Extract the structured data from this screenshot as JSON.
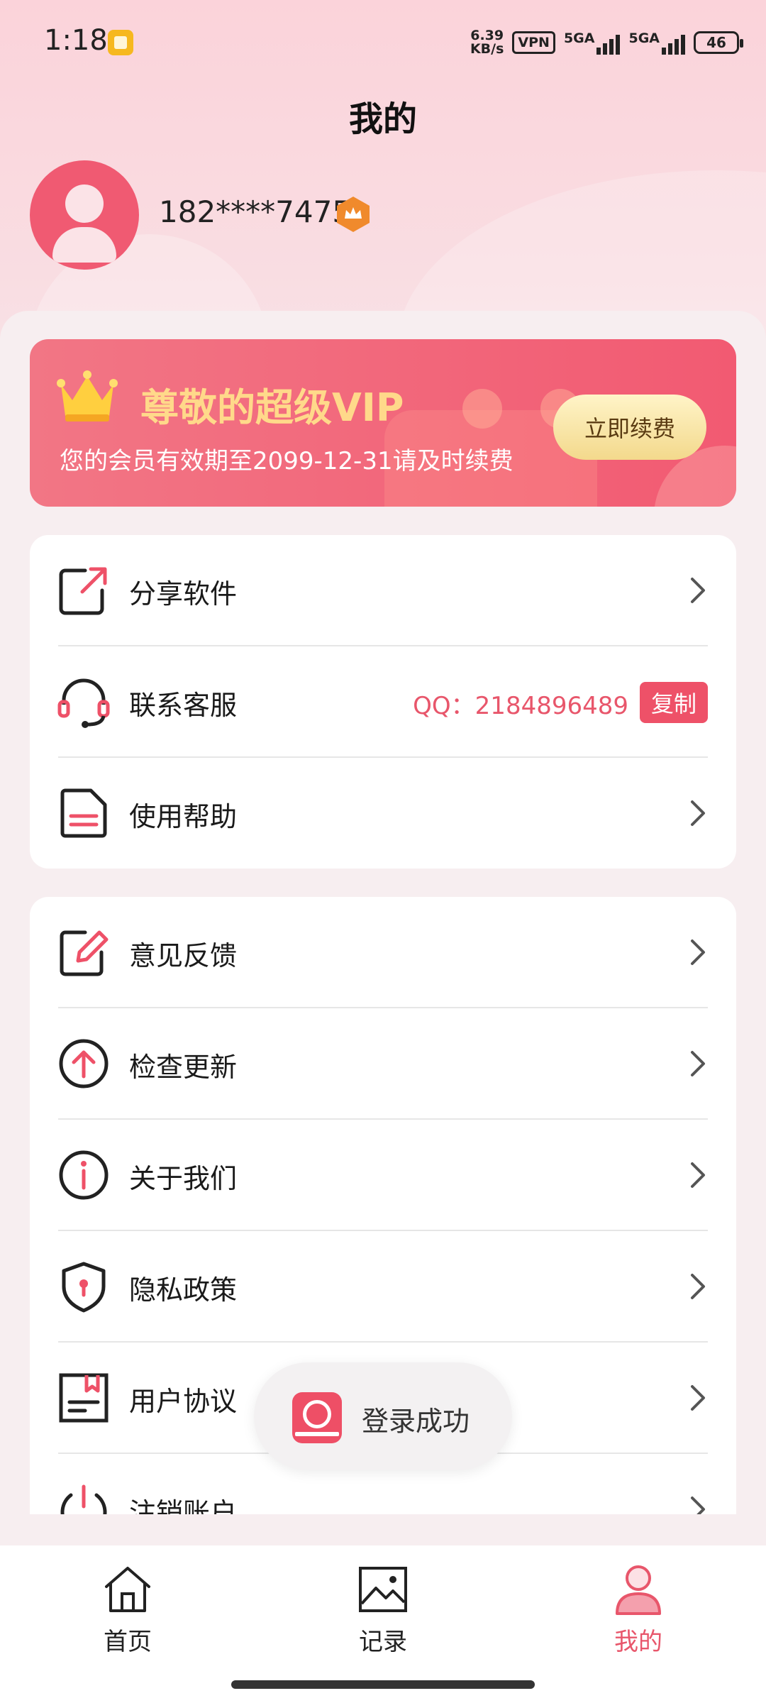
{
  "status_bar": {
    "time": "1:18",
    "speed_value": "6.39",
    "speed_unit": "KB/s",
    "vpn": "VPN",
    "signal1": "5GA",
    "signal2": "5GA",
    "battery": "46"
  },
  "header": {
    "title": "我的"
  },
  "profile": {
    "phone": "182****7475"
  },
  "vip": {
    "title": "尊敬的超级VIP",
    "subtitle": "您的会员有效期至2099-12-31请及时续费",
    "renew_label": "立即续费"
  },
  "menu_group1": {
    "items": [
      {
        "label": "分享软件"
      },
      {
        "label": "联系客服",
        "qq": "QQ：2184896489",
        "copy_label": "复制"
      },
      {
        "label": "使用帮助"
      }
    ]
  },
  "menu_group2": {
    "items": [
      {
        "label": "意见反馈"
      },
      {
        "label": "检查更新"
      },
      {
        "label": "关于我们"
      },
      {
        "label": "隐私政策"
      },
      {
        "label": "用户协议"
      },
      {
        "label": "注销账户"
      }
    ]
  },
  "toast": {
    "text": "登录成功"
  },
  "tabs": [
    {
      "label": "首页"
    },
    {
      "label": "记录"
    },
    {
      "label": "我的"
    }
  ],
  "colors": {
    "accent": "#e8566b",
    "vip_gold": "#ffd98a"
  }
}
